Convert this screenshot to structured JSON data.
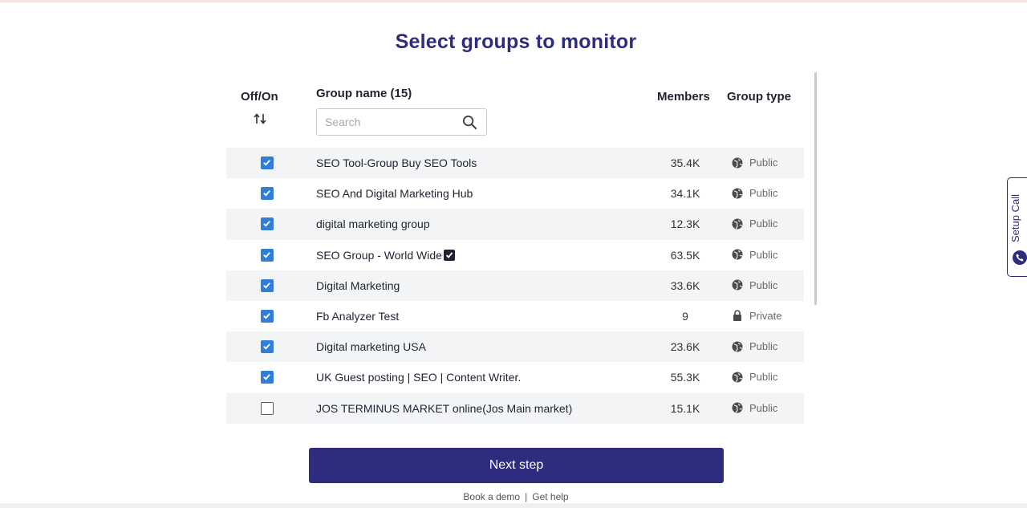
{
  "page": {
    "title": "Select groups to monitor"
  },
  "table": {
    "headers": {
      "offon": "Off/On",
      "group_name": "Group name (15)",
      "members": "Members",
      "group_type": "Group type"
    },
    "search": {
      "placeholder": "Search",
      "value": ""
    },
    "rows": [
      {
        "checked": true,
        "name": "SEO Tool-Group Buy SEO Tools",
        "verified": false,
        "members": "35.4K",
        "type": "Public",
        "type_icon": "globe-icon"
      },
      {
        "checked": true,
        "name": "SEO And Digital Marketing Hub",
        "verified": false,
        "members": "34.1K",
        "type": "Public",
        "type_icon": "globe-icon"
      },
      {
        "checked": true,
        "name": "digital marketing group",
        "verified": false,
        "members": "12.3K",
        "type": "Public",
        "type_icon": "globe-icon"
      },
      {
        "checked": true,
        "name": "SEO Group - World Wide",
        "verified": true,
        "members": "63.5K",
        "type": "Public",
        "type_icon": "globe-icon"
      },
      {
        "checked": true,
        "name": "Digital Marketing",
        "verified": false,
        "members": "33.6K",
        "type": "Public",
        "type_icon": "globe-icon"
      },
      {
        "checked": true,
        "name": "Fb Analyzer Test",
        "verified": false,
        "members": "9",
        "type": "Private",
        "type_icon": "lock-icon"
      },
      {
        "checked": true,
        "name": "Digital marketing USA",
        "verified": false,
        "members": "23.6K",
        "type": "Public",
        "type_icon": "globe-icon"
      },
      {
        "checked": true,
        "name": "UK Guest posting | SEO | Content Writer.",
        "verified": false,
        "members": "55.3K",
        "type": "Public",
        "type_icon": "globe-icon"
      },
      {
        "checked": false,
        "name": "JOS TERMINUS MARKET online(Jos Main market)",
        "verified": false,
        "members": "15.1K",
        "type": "Public",
        "type_icon": "globe-icon"
      }
    ]
  },
  "actions": {
    "next_label": "Next step",
    "book_demo": "Book a demo",
    "separator": "|",
    "get_help": "Get help"
  },
  "side_tab": {
    "label": "Setup Call"
  },
  "colors": {
    "brand": "#2e2c7e",
    "checkbox": "#2f7ed8",
    "row_shade": "#f3f4f6"
  }
}
